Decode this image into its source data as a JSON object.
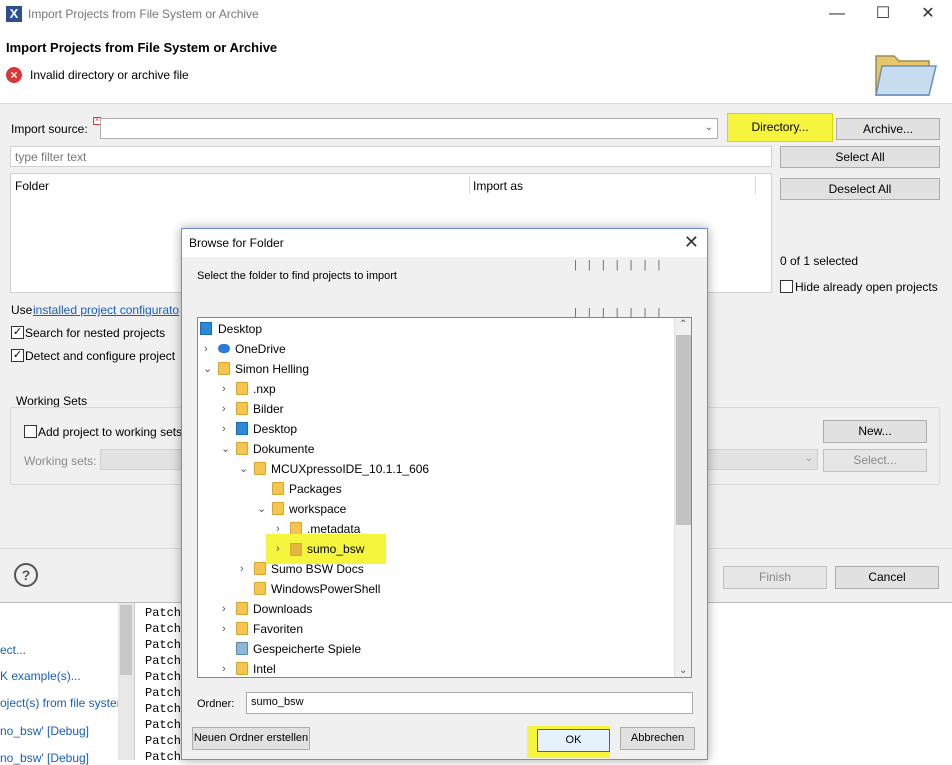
{
  "window": {
    "title": "Import Projects from File System or Archive",
    "header_title": "Import Projects from File System or Archive",
    "error_message": "Invalid directory or archive file"
  },
  "import": {
    "source_label": "Import source:",
    "source_value": "",
    "directory_button": "Directory...",
    "archive_button": "Archive...",
    "filter_placeholder": "type filter text",
    "select_all": "Select All",
    "deselect_all": "Deselect All",
    "columns": [
      "Folder",
      "Import as"
    ],
    "selection_count": "0 of 1 selected",
    "hide_open_projects": "Hide already open projects",
    "use_prefix": "Use ",
    "use_link": "installed project configurato",
    "search_nested": "Search for nested projects",
    "detect_configure": "Detect and configure project",
    "working_sets_title": "Working Sets",
    "add_to_working_sets": "Add project to working sets",
    "working_sets_label": "Working sets:",
    "new_button": "New...",
    "select_button": "Select...",
    "finish_button": "Finish",
    "cancel_button": "Cancel"
  },
  "browse": {
    "title": "Browse for Folder",
    "instruction": "Select the folder to find projects to import",
    "tree": [
      {
        "label": "Desktop",
        "icon": "desktop-icon"
      },
      {
        "label": "OneDrive",
        "icon": "cloud-icon"
      },
      {
        "label": "Simon Helling",
        "icon": "user-folder-icon"
      },
      {
        "label": ".nxp",
        "icon": "folder-icon"
      },
      {
        "label": "Bilder",
        "icon": "pictures-folder-icon"
      },
      {
        "label": "Desktop",
        "icon": "desktop-folder-icon"
      },
      {
        "label": "Dokumente",
        "icon": "documents-folder-icon"
      },
      {
        "label": "MCUXpressoIDE_10.1.1_606",
        "icon": "folder-icon"
      },
      {
        "label": "Packages",
        "icon": "folder-icon"
      },
      {
        "label": "workspace",
        "icon": "folder-icon"
      },
      {
        "label": ".metadata",
        "icon": "folder-icon"
      },
      {
        "label": "sumo_bsw",
        "icon": "folder-icon"
      },
      {
        "label": "Sumo BSW Docs",
        "icon": "folder-icon"
      },
      {
        "label": "WindowsPowerShell",
        "icon": "folder-icon"
      },
      {
        "label": "Downloads",
        "icon": "downloads-folder-icon"
      },
      {
        "label": "Favoriten",
        "icon": "favorites-folder-icon"
      },
      {
        "label": "Gespeicherte Spiele",
        "icon": "games-folder-icon"
      },
      {
        "label": "Intel",
        "icon": "folder-icon"
      }
    ],
    "folder_label": "Ordner:",
    "folder_value": "sumo_bsw",
    "new_folder_button": "Neuen Ordner erstellen",
    "ok_button": "OK",
    "cancel_button": "Abbrechen"
  },
  "background": {
    "links": [
      "ect...",
      "K example(s)...",
      "oject(s) from file syster",
      "no_bsw' [Debug]",
      "no_bsw' [Debug]"
    ],
    "console_lines": [
      "Patch",
      "Patch",
      "Patch",
      "Patch",
      "Patch",
      "Patch",
      "Patch",
      "Patch",
      "Patch",
      "Patch"
    ]
  },
  "colors": {
    "highlight": "#f5f53d",
    "error": "#d9383a",
    "link": "#1a5fb4"
  }
}
